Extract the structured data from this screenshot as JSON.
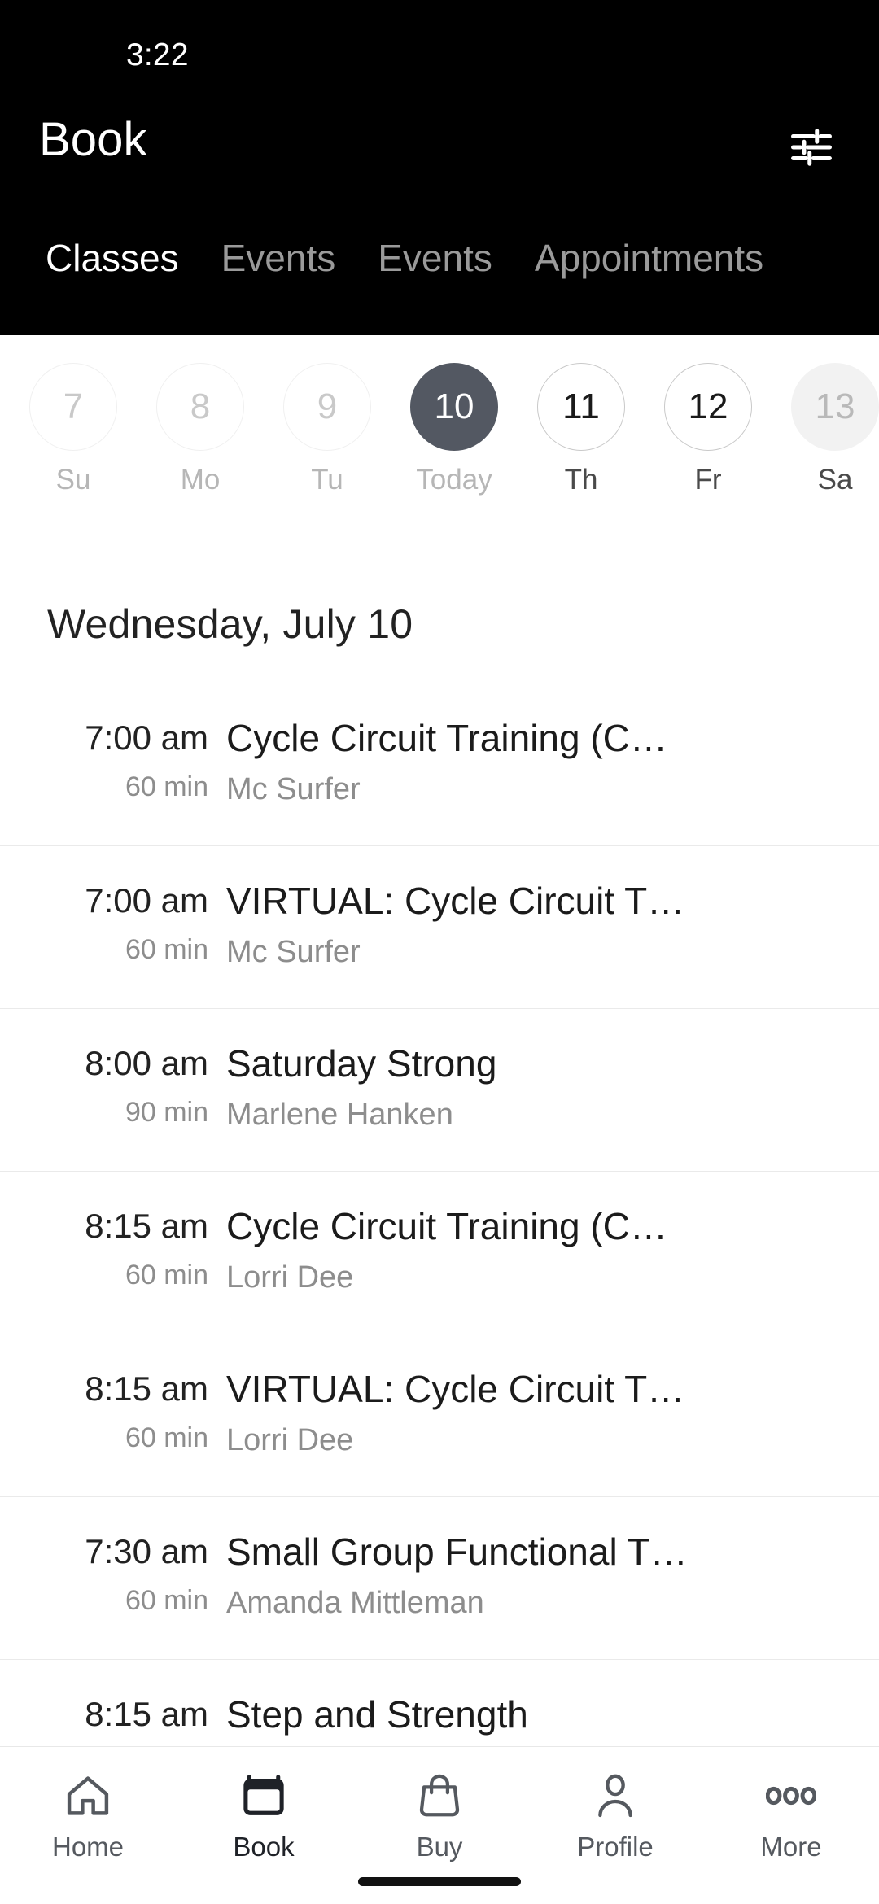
{
  "status_bar": {
    "time": "3:22"
  },
  "header": {
    "title": "Book",
    "filter_icon": "sliders-filter-icon"
  },
  "tabs": [
    {
      "label": "Classes",
      "active": true
    },
    {
      "label": "Events",
      "active": false
    },
    {
      "label": "Events",
      "active": false
    },
    {
      "label": "Appointments",
      "active": false
    }
  ],
  "date_strip": [
    {
      "day_number": "7",
      "weekday": "Su",
      "state": "past"
    },
    {
      "day_number": "8",
      "weekday": "Mo",
      "state": "past"
    },
    {
      "day_number": "9",
      "weekday": "Tu",
      "state": "past"
    },
    {
      "day_number": "10",
      "weekday": "Today",
      "state": "today"
    },
    {
      "day_number": "11",
      "weekday": "Th",
      "state": "future"
    },
    {
      "day_number": "12",
      "weekday": "Fr",
      "state": "future"
    },
    {
      "day_number": "13",
      "weekday": "Sa",
      "state": "muted"
    }
  ],
  "day_heading": "Wednesday, July 10",
  "classes": [
    {
      "time": "7:00 am",
      "duration": "60 min",
      "title": "Cycle Circuit Training (C…",
      "instructor": "Mc Surfer"
    },
    {
      "time": "7:00 am",
      "duration": "60 min",
      "title": "VIRTUAL: Cycle Circuit T…",
      "instructor": "Mc Surfer"
    },
    {
      "time": "8:00 am",
      "duration": "90 min",
      "title": "Saturday Strong",
      "instructor": "Marlene Hanken"
    },
    {
      "time": "8:15 am",
      "duration": "60 min",
      "title": "Cycle Circuit Training (C…",
      "instructor": "Lorri Dee"
    },
    {
      "time": "8:15 am",
      "duration": "60 min",
      "title": "VIRTUAL: Cycle Circuit T…",
      "instructor": "Lorri Dee"
    },
    {
      "time": "7:30 am",
      "duration": "60 min",
      "title": "Small Group Functional T…",
      "instructor": "Amanda Mittleman"
    },
    {
      "time": "8:15 am",
      "duration": "",
      "title": "Step and Strength",
      "instructor": ""
    }
  ],
  "bottom_nav": [
    {
      "label": "Home",
      "icon": "house-icon",
      "active": false
    },
    {
      "label": "Book",
      "icon": "calendar-icon",
      "active": true
    },
    {
      "label": "Buy",
      "icon": "shopping-bag-icon",
      "active": false
    },
    {
      "label": "Profile",
      "icon": "person-icon",
      "active": false
    },
    {
      "label": "More",
      "icon": "ellipsis-icon",
      "active": false
    }
  ],
  "colors": {
    "header_background": "#000000",
    "today_circle": "#535862",
    "page_background": "#ffffff",
    "primary_text": "#1b1b1b",
    "secondary_text": "#8d8d8d",
    "divider": "#eaeaea"
  }
}
